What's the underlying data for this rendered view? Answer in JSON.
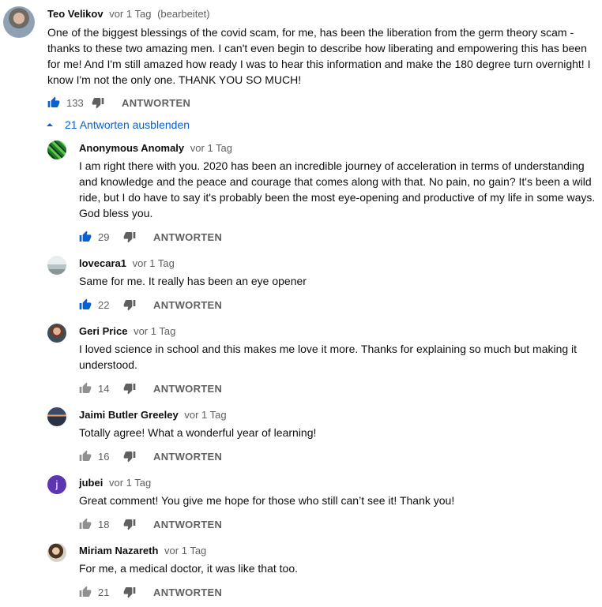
{
  "colors": {
    "like_active": "#065fd4",
    "icon_gray": "#606060",
    "link_blue": "#065fd4"
  },
  "main_comment": {
    "author": "Teo Velikov",
    "time": "vor 1 Tag",
    "edited": "(bearbeitet)",
    "text": "One of the biggest blessings of the covid scam, for me, has been the liberation from the germ theory scam - thanks to these two amazing men. I can't even begin to describe how liberating and empowering this has been for me! And I'm still amazed how ready I was to hear this information and make the 180 degree turn overnight! I know I'm not the only one. THANK YOU SO MUCH!",
    "likes": "133",
    "liked": true,
    "reply_label": "ANTWORTEN",
    "avatar_icon": "user-photo-avatar"
  },
  "replies_toggle": {
    "label": "21 Antworten ausblenden",
    "icon": "chevron-up-icon"
  },
  "replies": [
    {
      "author": "Anonymous Anomaly",
      "time": "vor 1 Tag",
      "text": "I am right there with you. 2020 has been an incredible journey of acceleration in terms of understanding and knowledge and the peace and courage that comes along with that. No pain, no gain? It's been a wild ride, but I do have to say it's probably been the most eye-opening and productive of my life in some ways. God bless you.",
      "likes": "29",
      "liked": true,
      "reply_label": "ANTWORTEN",
      "avatar_icon": "green-pattern-avatar"
    },
    {
      "author": "lovecara1",
      "time": "vor 1 Tag",
      "text": "Same for me. It really has been an eye opener",
      "likes": "22",
      "liked": true,
      "reply_label": "ANTWORTEN",
      "avatar_icon": "car-photo-avatar"
    },
    {
      "author": "Geri Price",
      "time": "vor 1 Tag",
      "text": "I loved science in school and this makes me love it more. Thanks for explaining so much but making it understood.",
      "likes": "14",
      "liked": false,
      "reply_label": "ANTWORTEN",
      "avatar_icon": "user-photo-avatar"
    },
    {
      "author": "Jaimi Butler Greeley",
      "time": "vor 1 Tag",
      "text": "Totally agree!  What a wonderful year of learning!",
      "likes": "16",
      "liked": false,
      "reply_label": "ANTWORTEN",
      "avatar_icon": "sunset-photo-avatar"
    },
    {
      "author": "jubei",
      "time": "vor 1 Tag",
      "text": "Great comment! You give me hope for those who still can’t see it! Thank you!",
      "likes": "18",
      "liked": false,
      "reply_label": "ANTWORTEN",
      "avatar_icon": "letter-avatar",
      "avatar_letter": "j"
    },
    {
      "author": "Miriam Nazareth",
      "time": "vor 1 Tag",
      "text": "For me, a medical doctor, it was like that too.",
      "likes": "21",
      "liked": false,
      "reply_label": "ANTWORTEN",
      "avatar_icon": "user-photo-avatar"
    }
  ]
}
